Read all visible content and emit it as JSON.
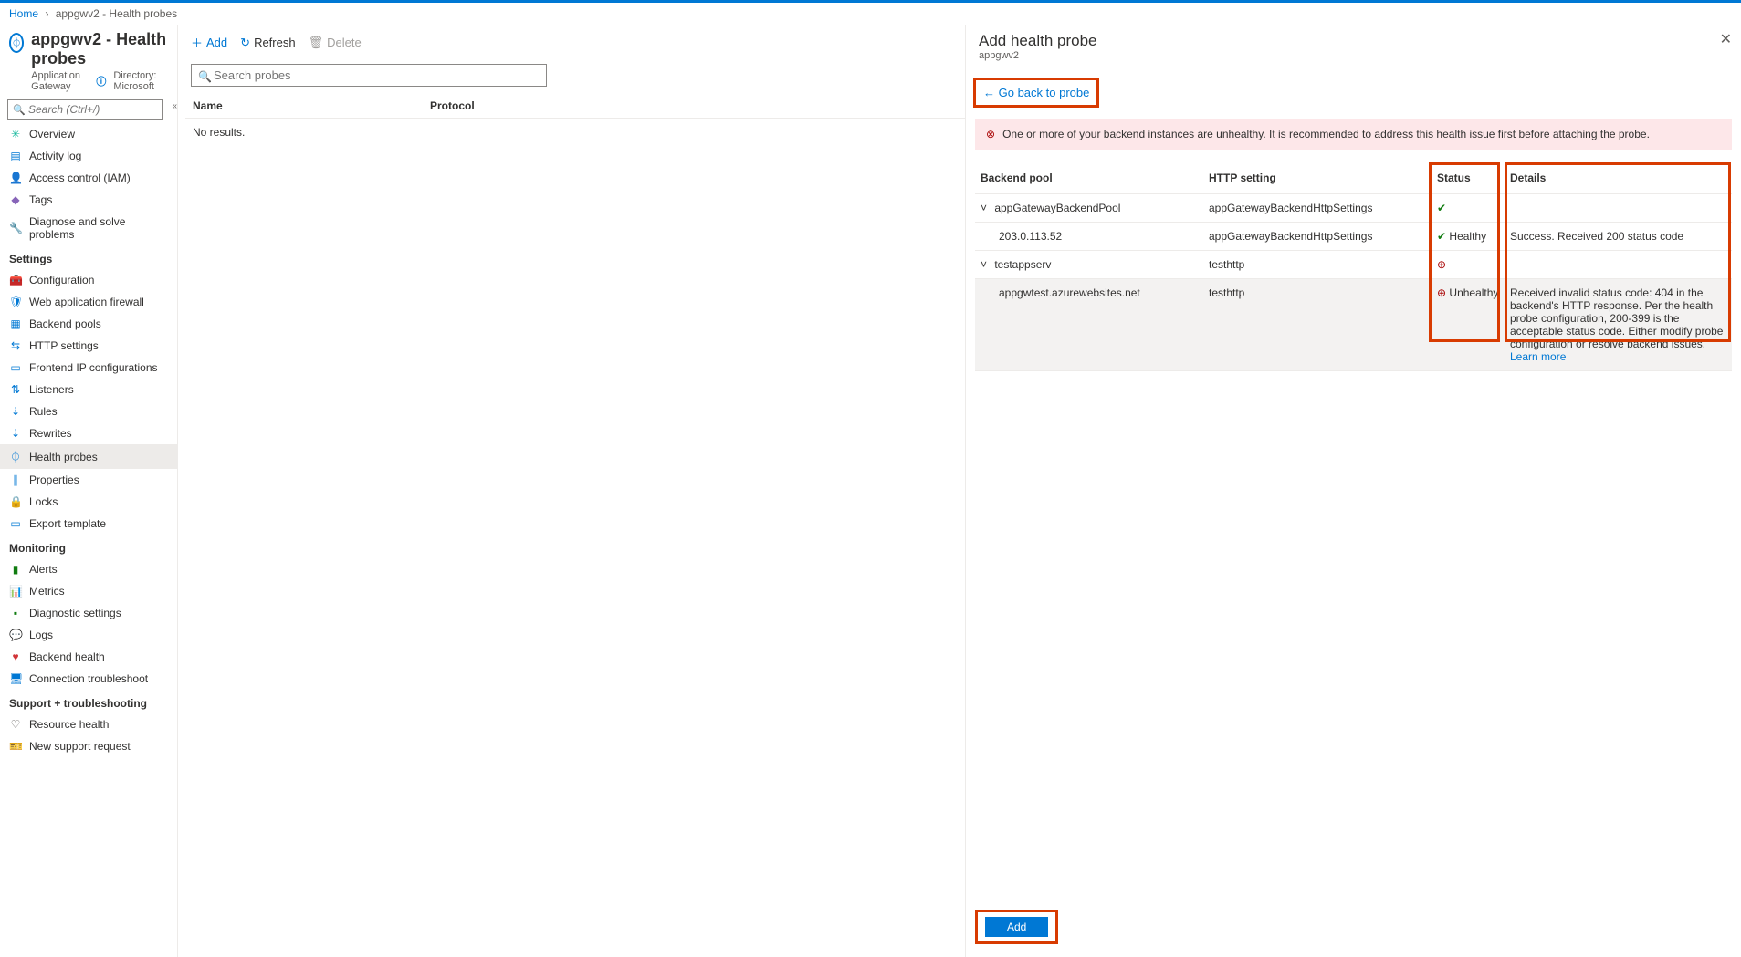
{
  "breadcrumb": {
    "home": "Home",
    "current": "appgwv2 - Health probes"
  },
  "page": {
    "title": "appgwv2 - Health probes",
    "subtitle": "Application Gateway",
    "directory_label": "Directory: Microsoft"
  },
  "search": {
    "placeholder": "Search (Ctrl+/)"
  },
  "nav": {
    "items": [
      {
        "icon": "✳",
        "color": "#00b294",
        "label": "Overview"
      },
      {
        "icon": "▤",
        "color": "#0078d4",
        "label": "Activity log"
      },
      {
        "icon": "👤",
        "color": "#0078d4",
        "label": "Access control (IAM)"
      },
      {
        "icon": "◆",
        "color": "#8764b8",
        "label": "Tags"
      },
      {
        "icon": "🔧",
        "color": "#605e5c",
        "label": "Diagnose and solve problems"
      }
    ],
    "settings_label": "Settings",
    "settings": [
      {
        "icon": "🧰",
        "color": "#d83b01",
        "label": "Configuration"
      },
      {
        "icon": "🛡",
        "color": "#0078d4",
        "label": "Web application firewall"
      },
      {
        "icon": "▦",
        "color": "#0078d4",
        "label": "Backend pools"
      },
      {
        "icon": "⇆",
        "color": "#0078d4",
        "label": "HTTP settings"
      },
      {
        "icon": "▭",
        "color": "#0078d4",
        "label": "Frontend IP configurations"
      },
      {
        "icon": "⇅",
        "color": "#0078d4",
        "label": "Listeners"
      },
      {
        "icon": "⇣",
        "color": "#0078d4",
        "label": "Rules"
      },
      {
        "icon": "⇣",
        "color": "#0078d4",
        "label": "Rewrites"
      },
      {
        "icon": "⏀",
        "color": "#0078d4",
        "label": "Health probes",
        "sel": true
      },
      {
        "icon": "∥",
        "color": "#0078d4",
        "label": "Properties"
      },
      {
        "icon": "🔒",
        "color": "#605e5c",
        "label": "Locks"
      },
      {
        "icon": "▭",
        "color": "#0078d4",
        "label": "Export template"
      }
    ],
    "monitoring_label": "Monitoring",
    "monitoring": [
      {
        "icon": "▮",
        "color": "#107c10",
        "label": "Alerts"
      },
      {
        "icon": "📊",
        "color": "#0078d4",
        "label": "Metrics"
      },
      {
        "icon": "▪",
        "color": "#107c10",
        "label": "Diagnostic settings"
      },
      {
        "icon": "💬",
        "color": "#0078d4",
        "label": "Logs"
      },
      {
        "icon": "♥",
        "color": "#d13438",
        "label": "Backend health"
      },
      {
        "icon": "🖥",
        "color": "#0078d4",
        "label": "Connection troubleshoot"
      }
    ],
    "support_label": "Support + troubleshooting",
    "support": [
      {
        "icon": "♡",
        "color": "#605e5c",
        "label": "Resource health"
      },
      {
        "icon": "🎫",
        "color": "#605e5c",
        "label": "New support request"
      }
    ]
  },
  "toolbar": {
    "add": "Add",
    "refresh": "Refresh",
    "del": "Delete"
  },
  "mainsearch": {
    "placeholder": "Search probes"
  },
  "list": {
    "col1": "Name",
    "col2": "Protocol",
    "empty": "No results."
  },
  "panel": {
    "title": "Add health probe",
    "sub": "appgwv2",
    "goback": "Go back to probe",
    "alert": "One or more of your backend instances are unhealthy. It is recommended to address this health issue first before attaching the probe.",
    "headers": {
      "pool": "Backend pool",
      "http": "HTTP setting",
      "status": "Status",
      "details": "Details"
    },
    "rows": [
      {
        "pool": "appGatewayBackendPool",
        "http": "appGatewayBackendHttpSettings",
        "status": "ok",
        "stext": "",
        "details": "",
        "chev": "˅",
        "top": true
      },
      {
        "pool": "203.0.113.52",
        "http": "appGatewayBackendHttpSettings",
        "status": "ok",
        "stext": "Healthy",
        "details": "Success. Received 200 status code",
        "indent": true
      },
      {
        "pool": "testappserv",
        "http": "testhttp",
        "status": "bad",
        "stext": "",
        "details": "",
        "chev": "˅",
        "top": true
      },
      {
        "pool": "appgwtest.azurewebsites.net",
        "http": "testhttp",
        "status": "bad",
        "stext": "Unhealthy",
        "details": "Received invalid status code: 404 in the backend's HTTP response. Per the health probe configuration, 200-399 is the acceptable status code. Either modify probe configuration or resolve backend issues.",
        "learn": "Learn more",
        "indent": true,
        "sel": true
      }
    ],
    "addbtn": "Add"
  }
}
